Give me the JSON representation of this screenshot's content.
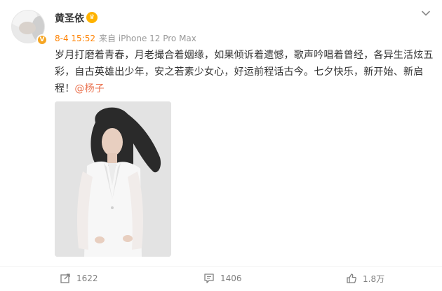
{
  "post": {
    "author": "黄圣依",
    "time": "8-4 15:52",
    "source": "来自 iPhone 12 Pro Max",
    "lines": [
      "岁月打磨着青春，月老撮合着姻缘，如果倾诉着遗憾，歌声吟唱着曾经，各异生活炫五",
      "彩，自古英雄出少年，安之若素少女心，好运前程话古今。七夕快乐，新开始、新启",
      "程！"
    ],
    "mention": "@杨子"
  },
  "actions": {
    "repost_count": "1622",
    "comment_count": "1406",
    "like_count": "1.8万"
  },
  "icons": {
    "verified": "verified-v-icon",
    "member_crown": "vip-crown-icon",
    "more": "chevron-down-icon",
    "repost": "repost-icon",
    "comment": "comment-icon",
    "like": "thumbs-up-icon"
  },
  "colors": {
    "time_accent": "#ff8200",
    "mention": "#eb7350",
    "verified_badge": "#f6a623"
  }
}
